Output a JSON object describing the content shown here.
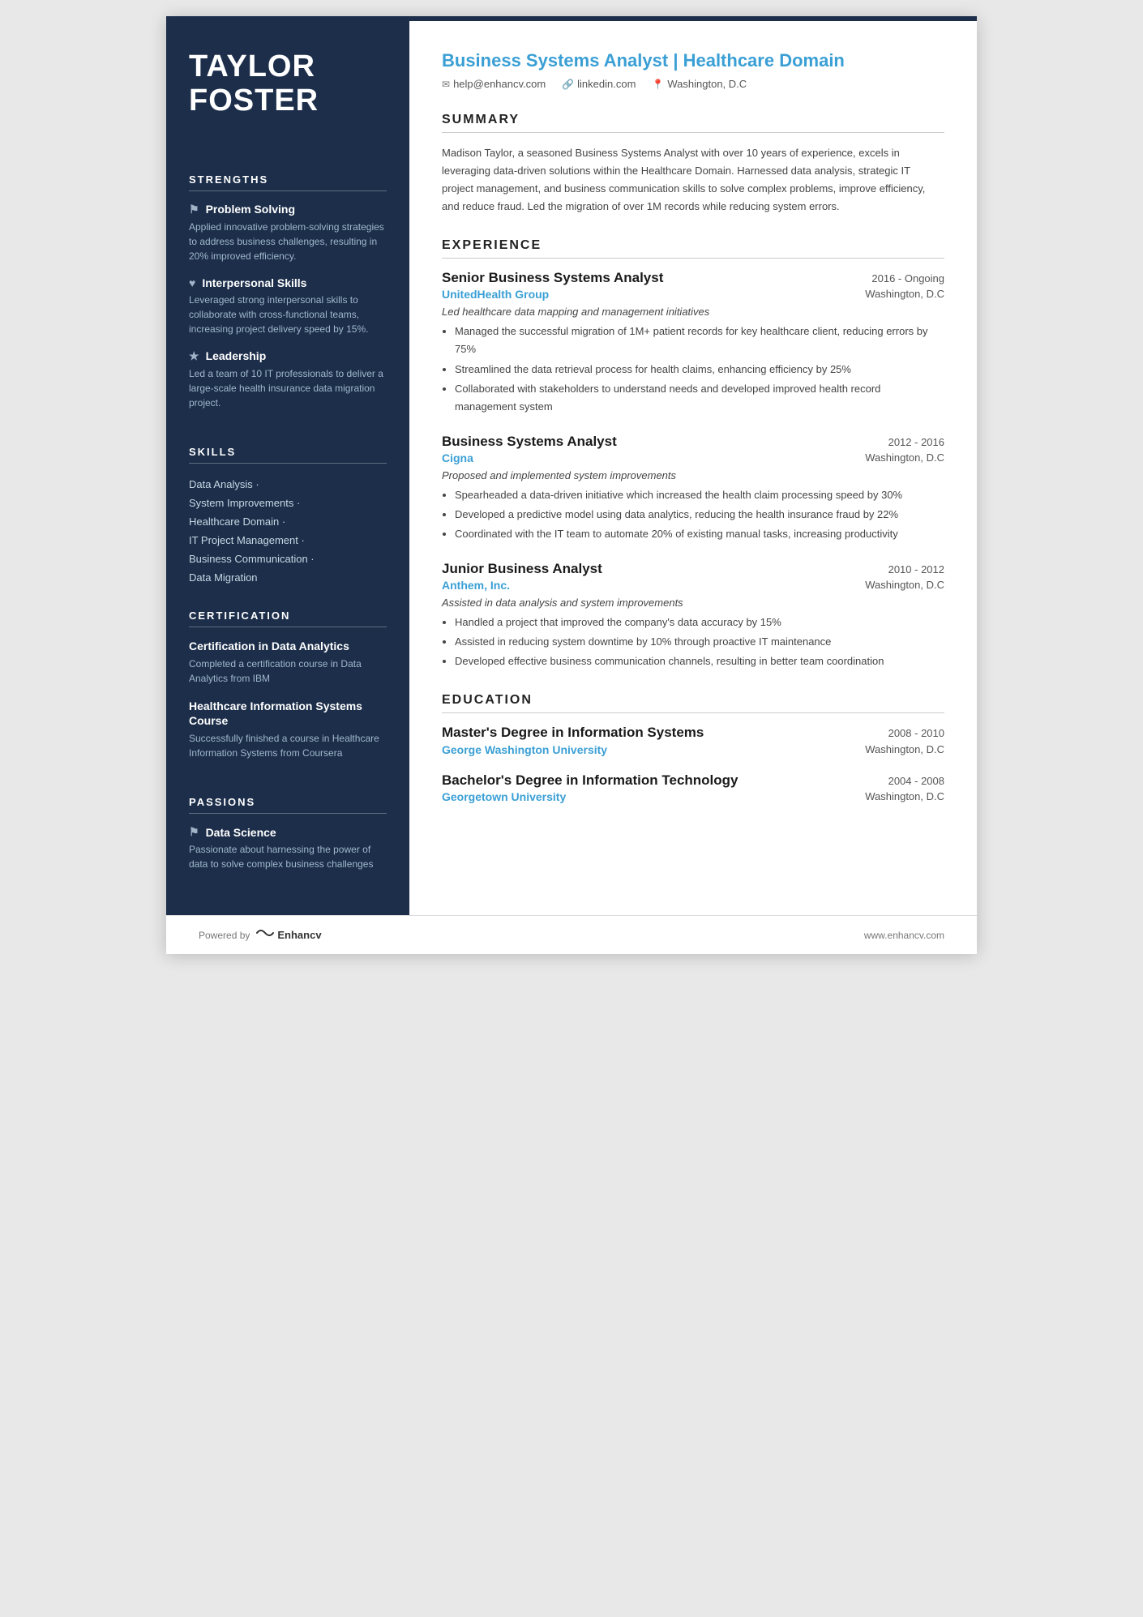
{
  "header_bar": "",
  "sidebar": {
    "name_line1": "TAYLOR",
    "name_line2": "FOSTER",
    "sections": {
      "strengths_title": "STRENGTHS",
      "strengths": [
        {
          "icon": "🚩",
          "title": "Problem Solving",
          "desc": "Applied innovative problem-solving strategies to address business challenges, resulting in 20% improved efficiency."
        },
        {
          "icon": "♥",
          "title": "Interpersonal Skills",
          "desc": "Leveraged strong interpersonal skills to collaborate with cross-functional teams, increasing project delivery speed by 15%."
        },
        {
          "icon": "★",
          "title": "Leadership",
          "desc": "Led a team of 10 IT professionals to deliver a large-scale health insurance data migration project."
        }
      ],
      "skills_title": "SKILLS",
      "skills": [
        "Data Analysis ·",
        "System Improvements ·",
        "Healthcare Domain ·",
        "IT Project Management ·",
        "Business Communication ·",
        "Data Migration"
      ],
      "certification_title": "CERTIFICATION",
      "certifications": [
        {
          "title": "Certification in Data Analytics",
          "desc": "Completed a certification course in Data Analytics from IBM"
        },
        {
          "title": "Healthcare Information Systems Course",
          "desc": "Successfully finished a course in Healthcare Information Systems from Coursera"
        }
      ],
      "passions_title": "PASSIONS",
      "passions": [
        {
          "icon": "🚩",
          "title": "Data Science",
          "desc": "Passionate about harnessing the power of data to solve complex business challenges"
        }
      ]
    }
  },
  "main": {
    "job_title": "Business Systems Analyst | Healthcare Domain",
    "contact": {
      "email": "help@enhancv.com",
      "linkedin": "linkedin.com",
      "location": "Washington, D.C"
    },
    "summary": {
      "section_title": "SUMMARY",
      "text": "Madison Taylor, a seasoned Business Systems Analyst with over 10 years of experience, excels in leveraging data-driven solutions within the Healthcare Domain. Harnessed data analysis, strategic IT project management, and business communication skills to solve complex problems, improve efficiency, and reduce fraud. Led the migration of over 1M records while reducing system errors."
    },
    "experience": {
      "section_title": "EXPERIENCE",
      "items": [
        {
          "role": "Senior Business Systems Analyst",
          "date": "2016 - Ongoing",
          "company": "UnitedHealth Group",
          "location": "Washington, D.C",
          "intro": "Led healthcare data mapping and management initiatives",
          "bullets": [
            "Managed the successful migration of 1M+ patient records for key healthcare client, reducing errors by 75%",
            "Streamlined the data retrieval process for health claims, enhancing efficiency by 25%",
            "Collaborated with stakeholders to understand needs and developed improved health record management system"
          ]
        },
        {
          "role": "Business Systems Analyst",
          "date": "2012 - 2016",
          "company": "Cigna",
          "location": "Washington, D.C",
          "intro": "Proposed and implemented system improvements",
          "bullets": [
            "Spearheaded a data-driven initiative which increased the health claim processing speed by 30%",
            "Developed a predictive model using data analytics, reducing the health insurance fraud by 22%",
            "Coordinated with the IT team to automate 20% of existing manual tasks, increasing productivity"
          ]
        },
        {
          "role": "Junior Business Analyst",
          "date": "2010 - 2012",
          "company": "Anthem, Inc.",
          "location": "Washington, D.C",
          "intro": "Assisted in data analysis and system improvements",
          "bullets": [
            "Handled a project that improved the company's data accuracy by 15%",
            "Assisted in reducing system downtime by 10% through proactive IT maintenance",
            "Developed effective business communication channels, resulting in better team coordination"
          ]
        }
      ]
    },
    "education": {
      "section_title": "EDUCATION",
      "items": [
        {
          "degree": "Master's Degree in Information Systems",
          "date": "2008 - 2010",
          "school": "George Washington University",
          "location": "Washington, D.C"
        },
        {
          "degree": "Bachelor's Degree in Information Technology",
          "date": "2004 - 2008",
          "school": "Georgetown University",
          "location": "Washington, D.C"
        }
      ]
    }
  },
  "footer": {
    "powered_by": "Powered by",
    "brand": "Enhancv",
    "website": "www.enhancv.com"
  }
}
